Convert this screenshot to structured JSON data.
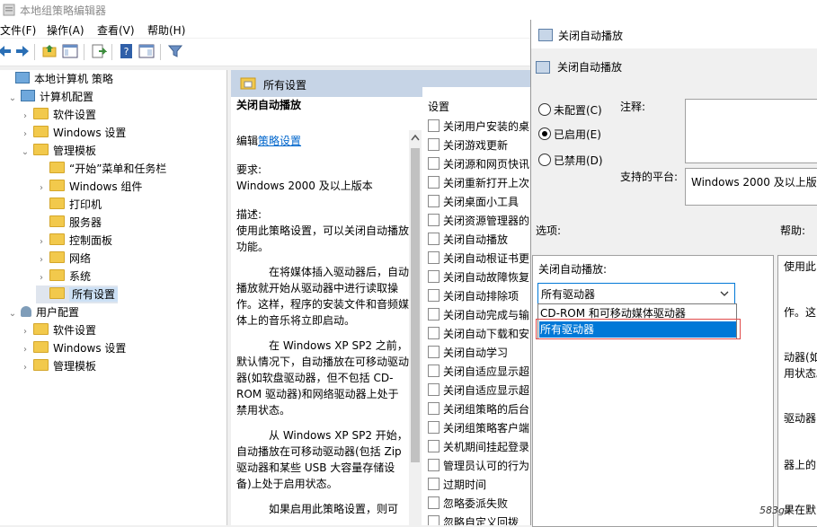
{
  "window": {
    "title": "本地组策略编辑器"
  },
  "menu": [
    "文件(F)",
    "操作(A)",
    "查看(V)",
    "帮助(H)"
  ],
  "tree": {
    "items": [
      {
        "label": "本地计算机 策略",
        "indent": 0,
        "twisty": "",
        "icon": "pc"
      },
      {
        "label": "计算机配置",
        "indent": 1,
        "twisty": "v",
        "icon": "pc"
      },
      {
        "label": "软件设置",
        "indent": 2,
        "twisty": ">",
        "icon": "folder"
      },
      {
        "label": "Windows 设置",
        "indent": 2,
        "twisty": ">",
        "icon": "folder"
      },
      {
        "label": "管理模板",
        "indent": 2,
        "twisty": "v",
        "icon": "folder"
      },
      {
        "label": "“开始”菜单和任务栏",
        "indent": 3,
        "twisty": "",
        "icon": "folder"
      },
      {
        "label": "Windows 组件",
        "indent": 3,
        "twisty": ">",
        "icon": "folder"
      },
      {
        "label": "打印机",
        "indent": 3,
        "twisty": "",
        "icon": "folder"
      },
      {
        "label": "服务器",
        "indent": 3,
        "twisty": "",
        "icon": "folder"
      },
      {
        "label": "控制面板",
        "indent": 3,
        "twisty": ">",
        "icon": "folder"
      },
      {
        "label": "网络",
        "indent": 3,
        "twisty": ">",
        "icon": "folder"
      },
      {
        "label": "系统",
        "indent": 3,
        "twisty": ">",
        "icon": "folder"
      },
      {
        "label": "所有设置",
        "indent": 3,
        "twisty": "",
        "icon": "folder",
        "selected": true
      },
      {
        "label": "用户配置",
        "indent": 1,
        "twisty": "v",
        "icon": "user"
      },
      {
        "label": "软件设置",
        "indent": 2,
        "twisty": ">",
        "icon": "folder"
      },
      {
        "label": "Windows 设置",
        "indent": 2,
        "twisty": ">",
        "icon": "folder"
      },
      {
        "label": "管理模板",
        "indent": 2,
        "twisty": ">",
        "icon": "folder"
      }
    ]
  },
  "middle": {
    "header": "所有设置",
    "policy_title": "关闭自动播放",
    "edit_prefix": "编辑",
    "edit_link": "策略设置",
    "requirement_label": "要求:",
    "requirement_value": "Windows 2000 及以上版本",
    "description_label": "描述:",
    "p1": "使用此策略设置，可以关闭自动播放功能。",
    "p2": "在将媒体插入驱动器后，自动播放就开始从驱动器中进行读取操作。这样，程序的安装文件和音频媒体上的音乐将立即启动。",
    "p3": "在 Windows XP SP2 之前，默认情况下，自动播放在可移动驱动器(如软盘驱动器，但不包括 CD-ROM 驱动器)和网络驱动器上处于禁用状态。",
    "p4": "从 Windows XP SP2 开始，自动播放在可移动驱动器(包括 Zip 驱动器和某些 USB 大容量存储设备)上处于启用状态。",
    "p5": "如果启用此策略设置，则可"
  },
  "settings_list": {
    "header": "设置",
    "items": [
      "关闭用户安装的桌",
      "关闭游戏更新",
      "关闭源和网页快讯",
      "关闭重新打开上次",
      "关闭桌面小工具",
      "关闭资源管理器的",
      "关闭自动播放",
      "关闭自动根证书更",
      "关闭自动故障恢复",
      "关闭自动排除项",
      "关闭自动完成与输",
      "关闭自动下载和安",
      "关闭自动学习",
      "关闭自适应显示超",
      "关闭自适应显示超",
      "关闭组策略的后台",
      "关闭组策略客户端",
      "关机期间挂起登录",
      "管理员认可的行为",
      "过期时间",
      "忽略委派失败",
      "忽略自定义回拨"
    ]
  },
  "dialog": {
    "title": "关闭自动播放",
    "subtitle": "关闭自动播放",
    "radio_not_configured": "未配置(C)",
    "radio_enabled": "已启用(E)",
    "radio_disabled": "已禁用(D)",
    "comment_label": "注释:",
    "platform_label": "支持的平台:",
    "platform_value": "Windows 2000 及以上版本",
    "options_label": "选项:",
    "help_label": "帮助:",
    "option_field_label": "关闭自动播放:",
    "combo_value": "所有驱动器",
    "dropdown_options": [
      "CD-ROM 和可移动媒体驱动器",
      "所有驱动器"
    ],
    "help_fragments": [
      "使用此",
      "作。这",
      "动器(如",
      "用状态。",
      "驱动器",
      "器上的",
      "果在默"
    ]
  },
  "watermark": "583ga"
}
